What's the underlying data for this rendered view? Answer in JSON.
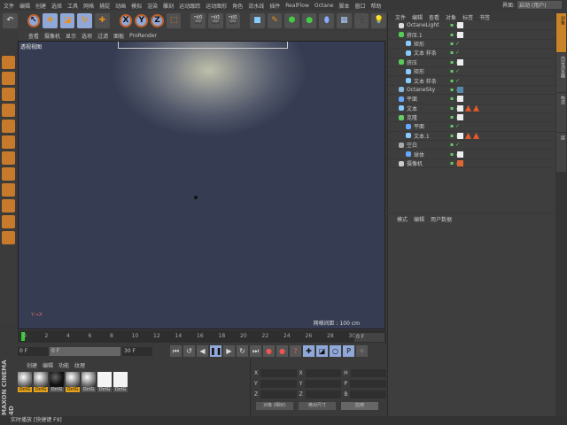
{
  "menu": [
    "文件",
    "编辑",
    "创建",
    "选择",
    "工具",
    "网格",
    "捕捉",
    "动画",
    "模拟",
    "渲染",
    "雕刻",
    "运动跟踪",
    "运动图形",
    "角色",
    "流水线",
    "插件",
    "RealFlow",
    "Octane",
    "脚本",
    "窗口",
    "帮助"
  ],
  "interface": {
    "label": "界面:",
    "value": "启动 (用户)"
  },
  "toolbar": {
    "x": "X",
    "y": "Y",
    "z": "Z"
  },
  "viewport": {
    "menu": [
      "查看",
      "摄像机",
      "显示",
      "选项",
      "过滤",
      "面板",
      "ProRender"
    ],
    "label": "透视视图",
    "grid": "网格间距 : 100 cm",
    "axis": "Y→X"
  },
  "timeline": {
    "ticks": [
      "0",
      "2",
      "4",
      "6",
      "8",
      "10",
      "12",
      "14",
      "16",
      "18",
      "20",
      "22",
      "24",
      "26",
      "28",
      "30"
    ],
    "end_frame": "0 F",
    "current_frame": "0 F",
    "min": "0 F",
    "max": "30 F",
    "range_start": "0 F",
    "range_end": "30 F"
  },
  "materials": {
    "menu": [
      "创建",
      "编辑",
      "功能",
      "纹理"
    ],
    "items": [
      {
        "label": "OctG",
        "active": true
      },
      {
        "label": "OctG",
        "active": true
      },
      {
        "label": "OctG",
        "active": false
      },
      {
        "label": "OctG",
        "active": true
      },
      {
        "label": "OctG",
        "active": false
      },
      {
        "label": "OctG",
        "active": false
      },
      {
        "label": "OctG",
        "active": false
      }
    ]
  },
  "coords": {
    "rows": [
      [
        "X",
        "X",
        "H"
      ],
      [
        "Y",
        "Y",
        "P"
      ],
      [
        "Z",
        "Z",
        "B"
      ]
    ],
    "btn_obj": "对象 (相对)",
    "btn_size": "绝对尺寸",
    "apply": "应用"
  },
  "brand": "MAXON CINEMA 4D",
  "status": "实时播放 [快捷键 F9]",
  "object_manager": {
    "menu": [
      "文件",
      "编辑",
      "查看",
      "对象",
      "标签",
      "书签"
    ],
    "objects": [
      {
        "name": "OctaneLight",
        "depth": 0,
        "color": "#ddd"
      },
      {
        "name": "挤压.1",
        "depth": 0,
        "color": "#5c5"
      },
      {
        "name": "矩形",
        "depth": 1,
        "color": "#8cf"
      },
      {
        "name": "文本 样条",
        "depth": 1,
        "color": "#8cf"
      },
      {
        "name": "挤压",
        "depth": 0,
        "color": "#5c5"
      },
      {
        "name": "矩形",
        "depth": 1,
        "color": "#8cf"
      },
      {
        "name": "文本 样条",
        "depth": 1,
        "color": "#8cf"
      },
      {
        "name": "OctaneSky",
        "depth": 0,
        "color": "#8bd"
      },
      {
        "name": "平面",
        "depth": 0,
        "color": "#6af"
      },
      {
        "name": "文本",
        "depth": 0,
        "color": "#8cf"
      },
      {
        "name": "克隆",
        "depth": 0,
        "color": "#6c6"
      },
      {
        "name": "平面",
        "depth": 1,
        "color": "#6af"
      },
      {
        "name": "文本.1",
        "depth": 1,
        "color": "#8cf"
      },
      {
        "name": "空白",
        "depth": 0,
        "color": "#aaa"
      },
      {
        "name": "球体",
        "depth": 1,
        "color": "#6af"
      },
      {
        "name": "摄像机",
        "depth": 0,
        "color": "#ccc"
      }
    ]
  },
  "attribute_manager": {
    "menu": [
      "模式",
      "编辑",
      "用户数据"
    ]
  },
  "right_tabs": [
    "对象",
    "内容浏览器",
    "构造",
    "层"
  ]
}
